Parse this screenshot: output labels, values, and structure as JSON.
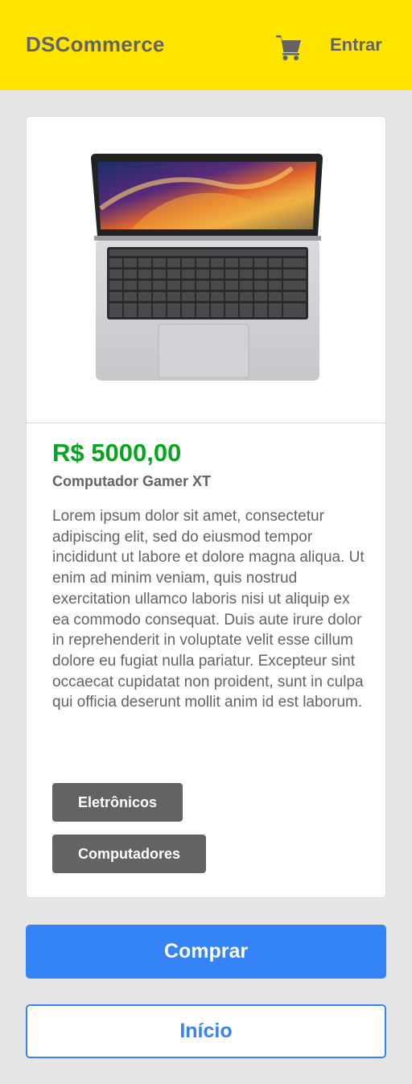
{
  "header": {
    "brand": "DSCommerce",
    "cart_icon": "cart-icon",
    "login_label": "Entrar",
    "background": "#ffe400"
  },
  "product": {
    "image_icon": "laptop-image",
    "price": "R$ 5000,00",
    "name": "Computador Gamer XT",
    "description": "Lorem ipsum dolor sit amet, consectetur adipiscing elit, sed do eiusmod tempor incididunt ut labore et dolore magna aliqua. Ut enim ad minim veniam, quis nostrud exercitation ullamco laboris nisi ut aliquip ex ea commodo consequat. Duis aute irure dolor in reprehenderit in voluptate velit esse cillum dolore eu fugiat nulla pariatur. Excepteur sint occaecat cupidatat non proident, sunt in culpa qui officia deserunt mollit anim id est laborum.",
    "categories": [
      "Eletrônicos",
      "Computadores"
    ],
    "price_color": "#08a41d"
  },
  "actions": {
    "buy_label": "Comprar",
    "home_label": "Início",
    "accent": "#3484f7"
  }
}
